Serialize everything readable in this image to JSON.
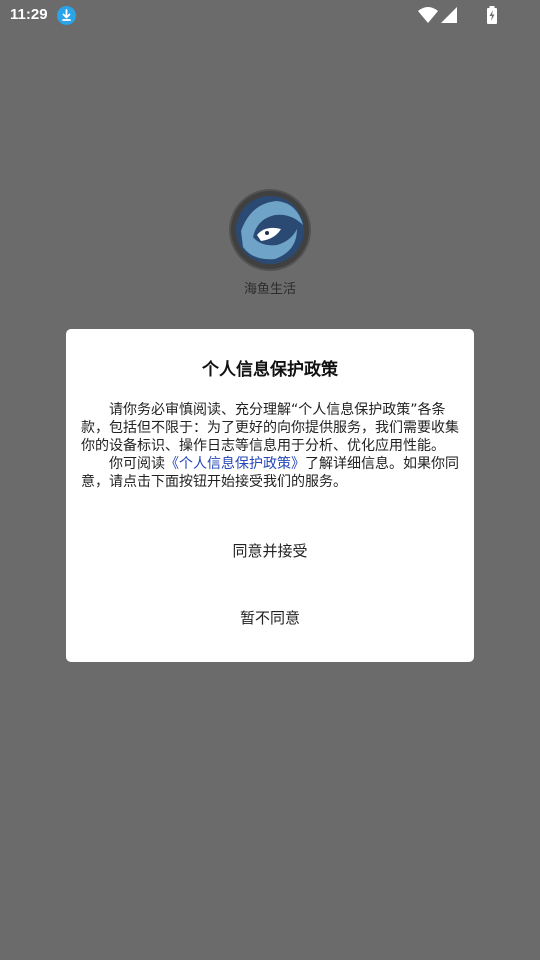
{
  "status_bar": {
    "time": "11:29",
    "icons": [
      "download-icon",
      "wifi-icon",
      "signal-icon",
      "battery-icon"
    ]
  },
  "app": {
    "name": "海鱼生活",
    "logo": "fish-logo-icon"
  },
  "dialog": {
    "title": "个人信息保护政策",
    "paragraph1": "请你务必审慎阅读、充分理解“个人信息保护政策”各条款，包括但不限于：为了更好的向你提供服务，我们需要收集你的设备标识、操作日志等信息用于分析、优化应用性能。",
    "paragraph2_prefix": "你可阅读",
    "policy_link": "《个人信息保护政策》",
    "paragraph2_suffix": "了解详细信息。如果你同意，请点击下面按钮开始接受我们的服务。",
    "agree_label": "同意并接受",
    "disagree_label": "暂不同意"
  },
  "colors": {
    "overlay": "#6b6b6b",
    "link": "#2747b8",
    "download_badge": "#2aa3e8"
  }
}
